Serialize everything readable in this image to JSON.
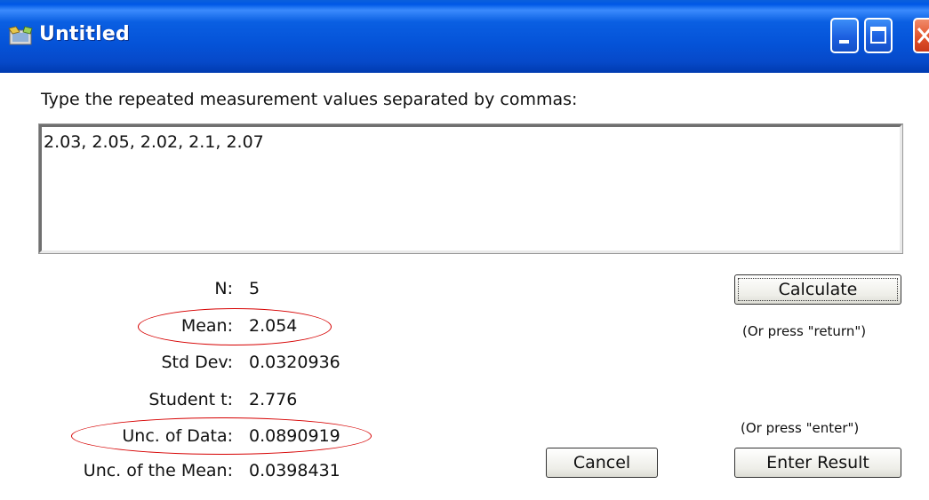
{
  "window": {
    "title": "Untitled",
    "icon": "app-icon",
    "controls": [
      "minimize-icon",
      "maximize-icon",
      "close-icon"
    ]
  },
  "prompt": "Type the repeated measurement values separated by commas:",
  "input_value": "2.03, 2.05, 2.02, 2.1, 2.07",
  "stats": {
    "n_label": "N:",
    "n_value": "5",
    "mean_label": "Mean:",
    "mean_value": "2.054",
    "std_label": "Std Dev:",
    "std_value": "0.0320936",
    "t_label": "Student t:",
    "t_value": "2.776",
    "unc_data_label": "Unc. of Data:",
    "unc_data_value": "0.0890919",
    "unc_mean_label": "Unc. of the Mean:",
    "unc_mean_value": "0.0398431"
  },
  "buttons": {
    "calculate": "Calculate",
    "calculate_hint": "(Or press \"return\")",
    "cancel": "Cancel",
    "enter_result": "Enter Result",
    "enter_hint": "(Or press \"enter\")"
  },
  "colors": {
    "titlebar": "#0553d8",
    "annotation": "#d60000"
  }
}
